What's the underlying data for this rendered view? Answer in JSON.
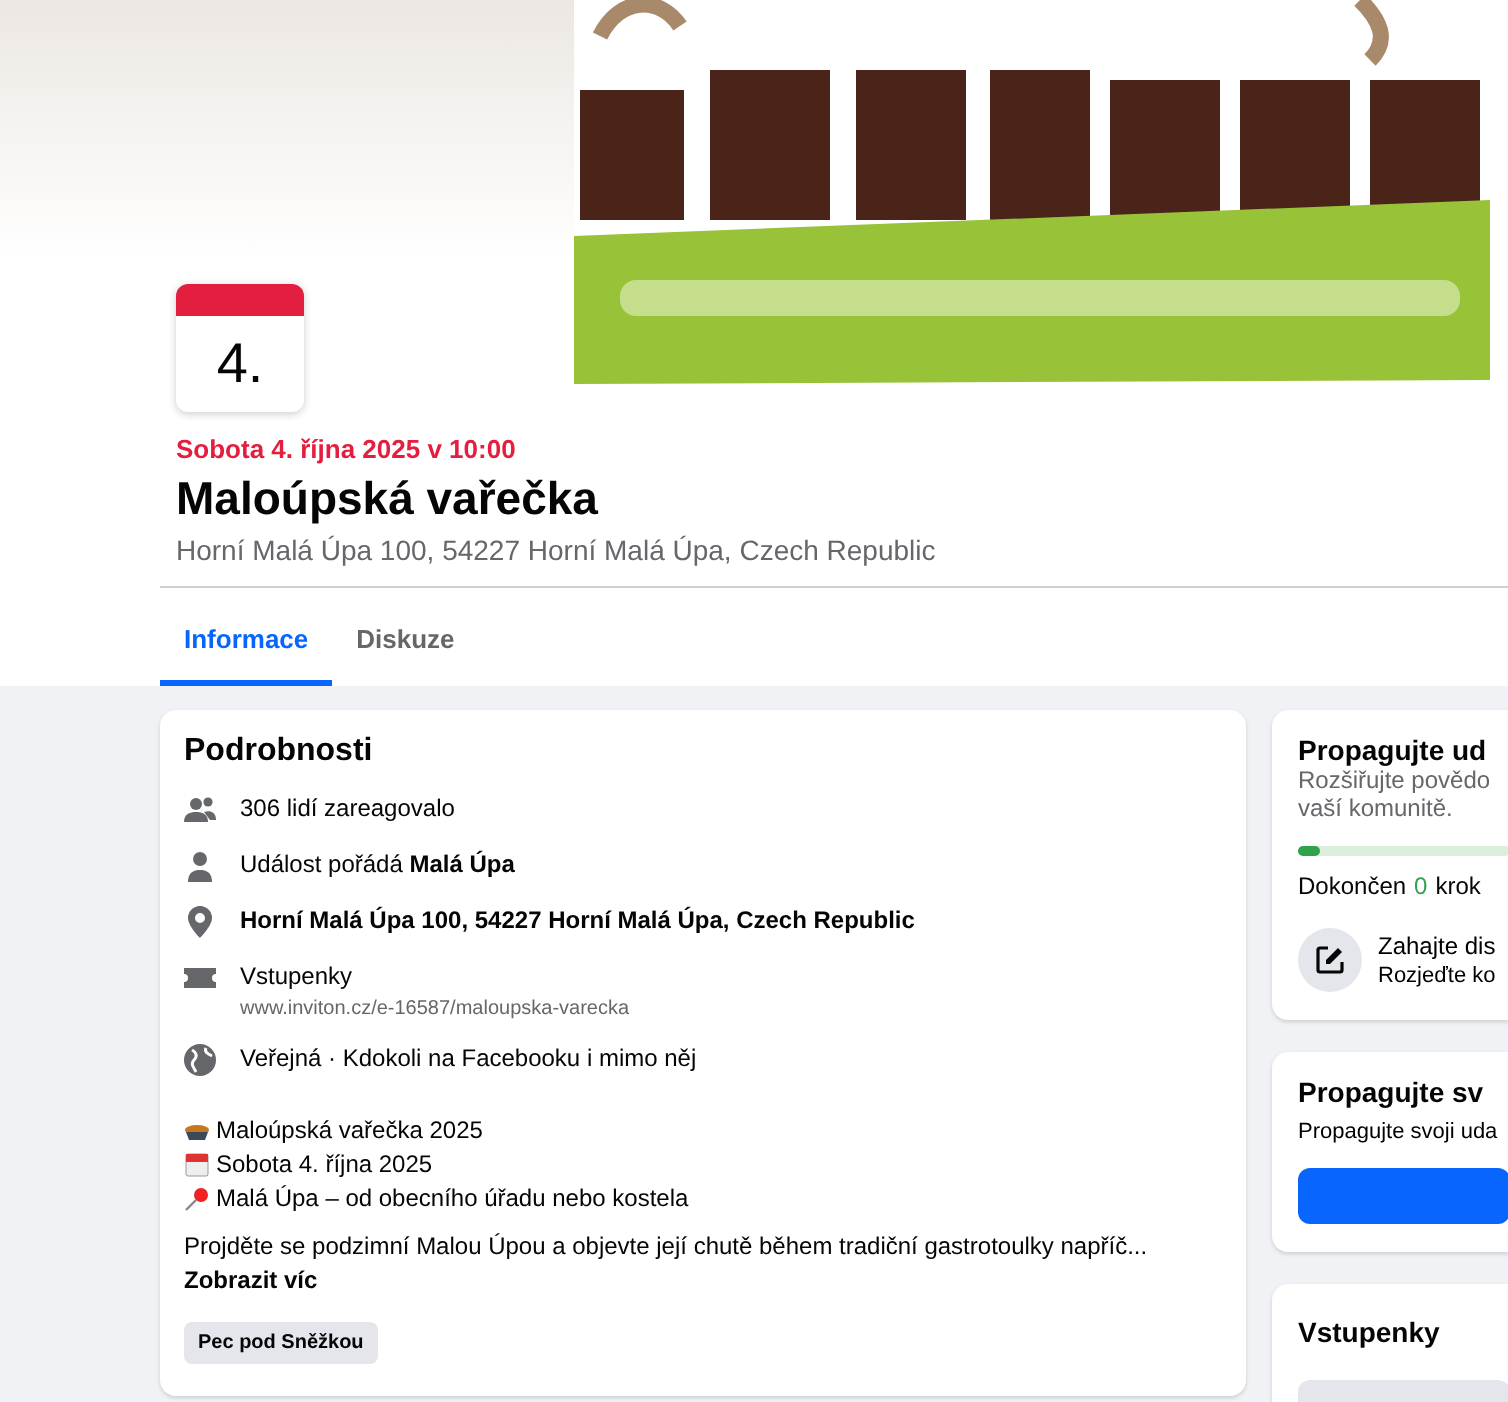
{
  "date_badge": {
    "day": "4."
  },
  "event": {
    "datetime": "Sobota 4. října 2025 v 10:00",
    "title": "Maloúpská vařečka",
    "address": "Horní Malá Úpa 100, 54227 Horní Malá Úpa, Czech Republic"
  },
  "tabs": [
    {
      "label": "Informace",
      "selected": true
    },
    {
      "label": "Diskuze",
      "selected": false
    }
  ],
  "details": {
    "title": "Podrobnosti",
    "rows": [
      {
        "kind": "people",
        "text": "306 lidí zareagovalo"
      },
      {
        "kind": "person",
        "text": "Událost pořádá **Malá Úpa**"
      },
      {
        "kind": "pin",
        "text": "**Horní Malá Úpa 100, 54227 Horní Malá Úpa, Czech Republic**"
      },
      {
        "kind": "ticket",
        "text": "Vstupenky",
        "link": "www.inviton.cz/e-16587/maloupska-varecka"
      },
      {
        "kind": "globe",
        "text": "Veřejná · Kdokoli na Facebooku i mimo něj"
      }
    ],
    "lines": [
      {
        "kind": "pot",
        "text": "Maloúpská vařečka 2025"
      },
      {
        "kind": "calendar",
        "text": "Sobota 4. října 2025"
      },
      {
        "kind": "pushpin",
        "text": "Malá Úpa – od obecního úřadu nebo kostela"
      }
    ],
    "description": "Projděte se podzimní Malou Úpou a objevte její chutě během tradiční gastrotoulky napříč...",
    "more": "Zobrazit víc",
    "tag": "Pec pod Sněžkou"
  },
  "promote_card": {
    "title": "Propagujte ud",
    "description": [
      "Rozšiřujte povědo",
      "vaší komunitě."
    ],
    "level": 0.1,
    "progress_prefix": "Dokončen",
    "progress_count": "0",
    "progress_suffix": "krok",
    "step_title": "Zahajte dis",
    "step_subtitle": "Rozjeďte ko"
  },
  "boost_card": {
    "title": "Propagujte sv",
    "description": "Propagujte svoji uda"
  },
  "tickets_card": {
    "title": "Vstupenky"
  }
}
